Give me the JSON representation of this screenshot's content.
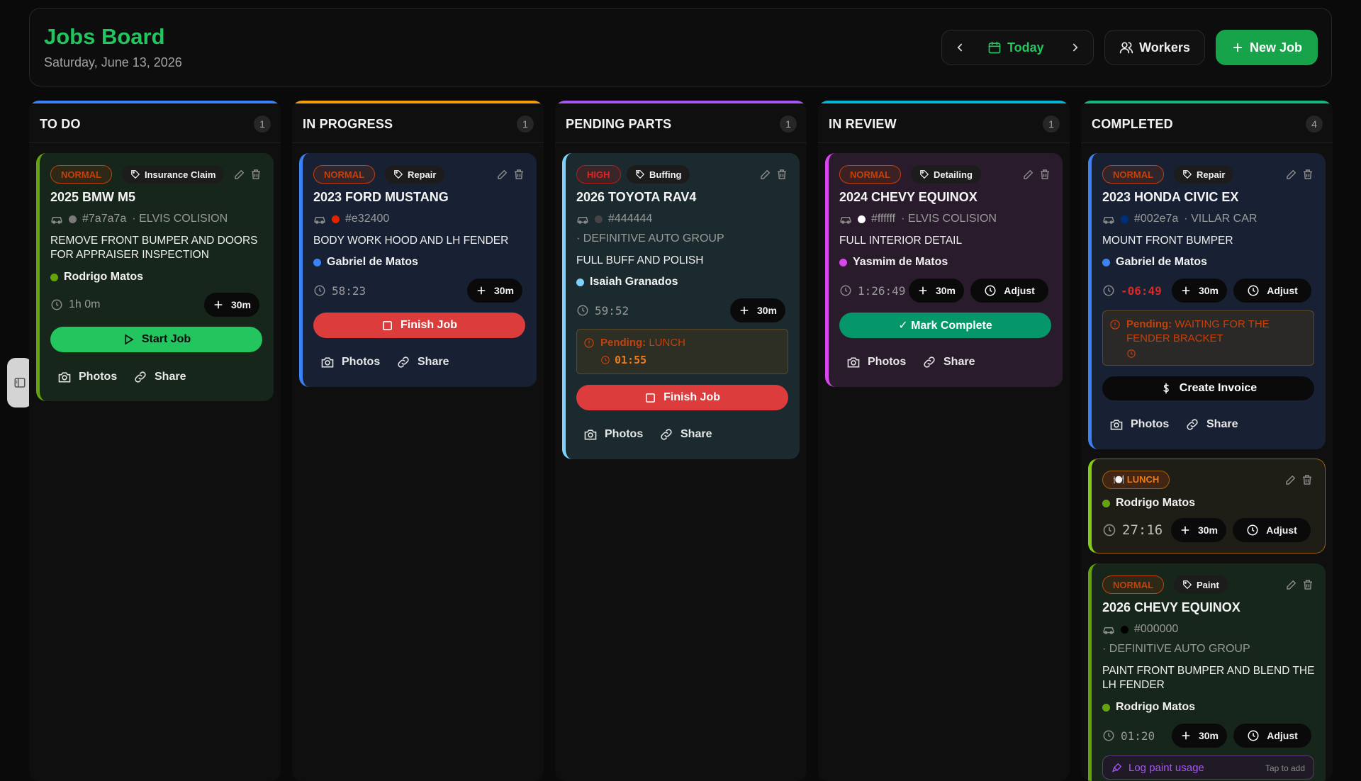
{
  "header": {
    "title": "Jobs Board",
    "date": "Saturday, June 13, 2026",
    "today_label": "Today",
    "workers_label": "Workers",
    "new_job_label": "New Job"
  },
  "labels": {
    "photos": "Photos",
    "share": "Share",
    "add_30m": "30m",
    "adjust": "Adjust"
  },
  "columns": [
    {
      "title": "TO DO",
      "count": "1",
      "color": "#3b82f6"
    },
    {
      "title": "IN PROGRESS",
      "count": "1",
      "color": "#f59e0b"
    },
    {
      "title": "PENDING PARTS",
      "count": "1",
      "color": "#a855f7"
    },
    {
      "title": "IN REVIEW",
      "count": "1",
      "color": "#06b6d4"
    },
    {
      "title": "COMPLETED",
      "count": "4",
      "color": "#10b981"
    }
  ],
  "cards": {
    "todo": {
      "priority": "NORMAL",
      "tag": "Insurance Claim",
      "title": "2025 BMW M5",
      "color_hex": "#7a7a7a",
      "shop": "· ELVIS COLISION",
      "description": "REMOVE FRONT BUMPER AND DOORS FOR APPRAISER INSPECTION",
      "worker": "Rodrigo Matos",
      "worker_color": "#65a30d",
      "timer": "1h 0m",
      "action": "Start Job"
    },
    "inprogress": {
      "priority": "NORMAL",
      "tag": "Repair",
      "title": "2023 FORD MUSTANG",
      "color_hex": "#e32400",
      "description": "BODY WORK HOOD AND LH FENDER",
      "worker": "Gabriel de Matos",
      "worker_color": "#3b82f6",
      "timer": "58:23",
      "action": "Finish Job"
    },
    "pending": {
      "priority": "HIGH",
      "tag": "Buffing",
      "title": "2026 TOYOTA RAV4",
      "color_hex": "#444444",
      "shop": "· DEFINITIVE AUTO GROUP",
      "description": "FULL BUFF AND POLISH",
      "worker": "Isaiah Granados",
      "worker_color": "#7dd3fc",
      "timer": "59:52",
      "pending_label": "Pending:",
      "pending_reason": "LUNCH",
      "pending_timer": "01:55",
      "action": "Finish Job"
    },
    "review": {
      "priority": "NORMAL",
      "tag": "Detailing",
      "title": "2024 CHEVY EQUINOX",
      "color_hex": "#ffffff",
      "shop": "· ELVIS COLISION",
      "description": "FULL INTERIOR DETAIL",
      "worker": "Yasmim de Matos",
      "worker_color": "#d946ef",
      "timer": "1:26:49",
      "action": "✓ Mark Complete"
    },
    "completed1": {
      "priority": "NORMAL",
      "tag": "Repair",
      "title": "2023 HONDA CIVIC EX",
      "color_hex": "#002e7a",
      "shop": "· VILLAR CAR",
      "description": "MOUNT FRONT BUMPER",
      "worker": "Gabriel de Matos",
      "worker_color": "#3b82f6",
      "timer": "-06:49",
      "pending_label": "Pending:",
      "pending_reason": "WAITING FOR THE FENDER BRACKET",
      "action": "Create Invoice"
    },
    "lunch": {
      "badge": "🍽️ LUNCH",
      "worker": "Rodrigo Matos",
      "worker_color": "#65a30d",
      "timer": "27:16"
    },
    "completed2": {
      "priority": "NORMAL",
      "tag": "Paint",
      "title": "2026 CHEVY EQUINOX",
      "color_hex": "#000000",
      "shop": "· DEFINITIVE AUTO GROUP",
      "description": "PAINT FRONT BUMPER AND BLEND THE LH FENDER",
      "worker": "Rodrigo Matos",
      "worker_color": "#65a30d",
      "timer": "01:20",
      "paint_log": "Log paint usage",
      "paint_hint": "Tap to add"
    }
  }
}
